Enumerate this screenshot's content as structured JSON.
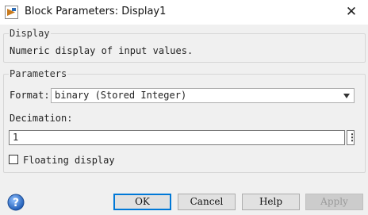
{
  "window": {
    "title": "Block Parameters: Display1",
    "close_glyph": "✕",
    "app_icon": "simulink-icon"
  },
  "display_group": {
    "label": "Display",
    "description": "Numeric display of input values."
  },
  "parameters_group": {
    "label": "Parameters",
    "format_label": "Format:",
    "format_value": "binary (Stored Integer)",
    "decimation_label": "Decimation:",
    "decimation_value": "1",
    "decimation_menu_glyph": "⋮",
    "floating_label": "Floating display",
    "floating_checked": false
  },
  "buttons": {
    "ok": "OK",
    "cancel": "Cancel",
    "help": "Help",
    "apply": "Apply"
  },
  "colors": {
    "accent": "#0078d7",
    "help_icon": "#2e6fc4"
  }
}
